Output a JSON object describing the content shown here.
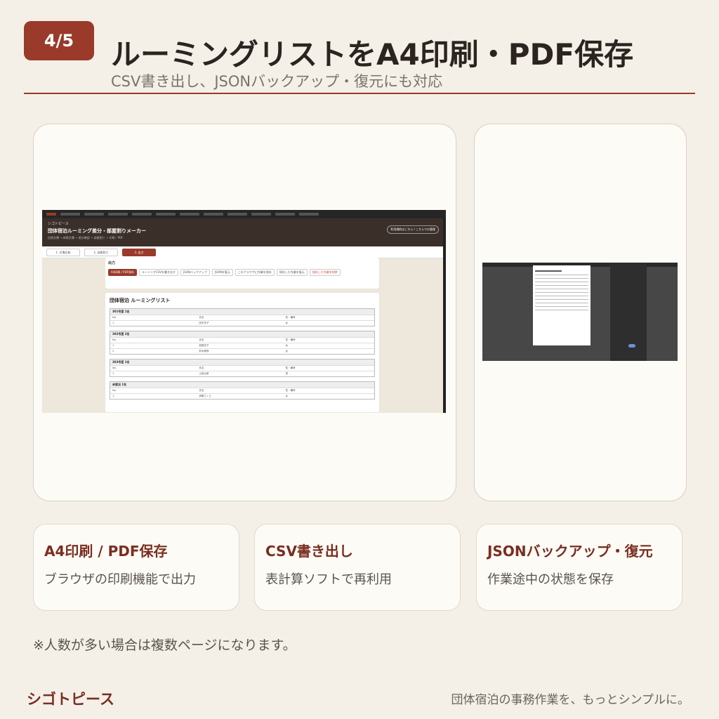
{
  "header": {
    "badge": "4/5",
    "title": "ルーミングリストをA4印刷・PDF保存",
    "subtitle": "CSV書き出し、JSONバックアップ・復元にも対応"
  },
  "screenshot_main": {
    "app_brand": "シゴトピース",
    "app_title": "団体宿泊ルーミング差分・部屋割りメーカー",
    "app_sub": "旧版名簿 → 新版名簿 → 差分確認 → 部屋割り → 印刷・PDF",
    "header_button": "利用規約はこちら / こちらでの管理",
    "steps": [
      "1. 名簿比較",
      "2. 部屋割り",
      "3. 出力"
    ],
    "output_heading": "出力",
    "output_buttons": [
      "A4印刷 / PDF保存",
      "ルーミングCSVを書き出す",
      "JSONバックアップ",
      "JSONを復元",
      "このブラウザに作業を保存",
      "保存した作業を復元",
      "保存した作業を削除"
    ],
    "list_title": "団体宿泊 ルーミングリスト",
    "rooms": [
      {
        "name": "301号室 1名",
        "guests": [
          [
            "1",
            "田中花子",
            "女"
          ]
        ]
      },
      {
        "name": "302号室 2名",
        "guests": [
          [
            "1",
            "佐藤花子",
            "女"
          ],
          [
            "2",
            "鈴木美咲",
            "女"
          ]
        ]
      },
      {
        "name": "303号室 1名",
        "guests": [
          [
            "1",
            "山田太郎",
            "男"
          ]
        ]
      },
      {
        "name": "未割当 1名",
        "guests": [
          [
            "1",
            "伊藤さくら",
            "女"
          ]
        ]
      }
    ],
    "col_no": "No.",
    "col_name": "氏名",
    "col_gender": "性・備考"
  },
  "features": [
    {
      "title": "A4印刷 / PDF保存",
      "desc": "ブラウザの印刷機能で出力"
    },
    {
      "title": "CSV書き出し",
      "desc": "表計算ソフトで再利用"
    },
    {
      "title": "JSONバックアップ・復元",
      "desc": "作業途中の状態を保存"
    }
  ],
  "footnote": "※人数が多い場合は複数ページになります。",
  "footer": {
    "brand": "シゴトピース",
    "tagline": "団体宿泊の事務作業を、もっとシンプルに。"
  },
  "colors": {
    "accent": "#9a3a2a",
    "background": "#f4f0e8"
  }
}
